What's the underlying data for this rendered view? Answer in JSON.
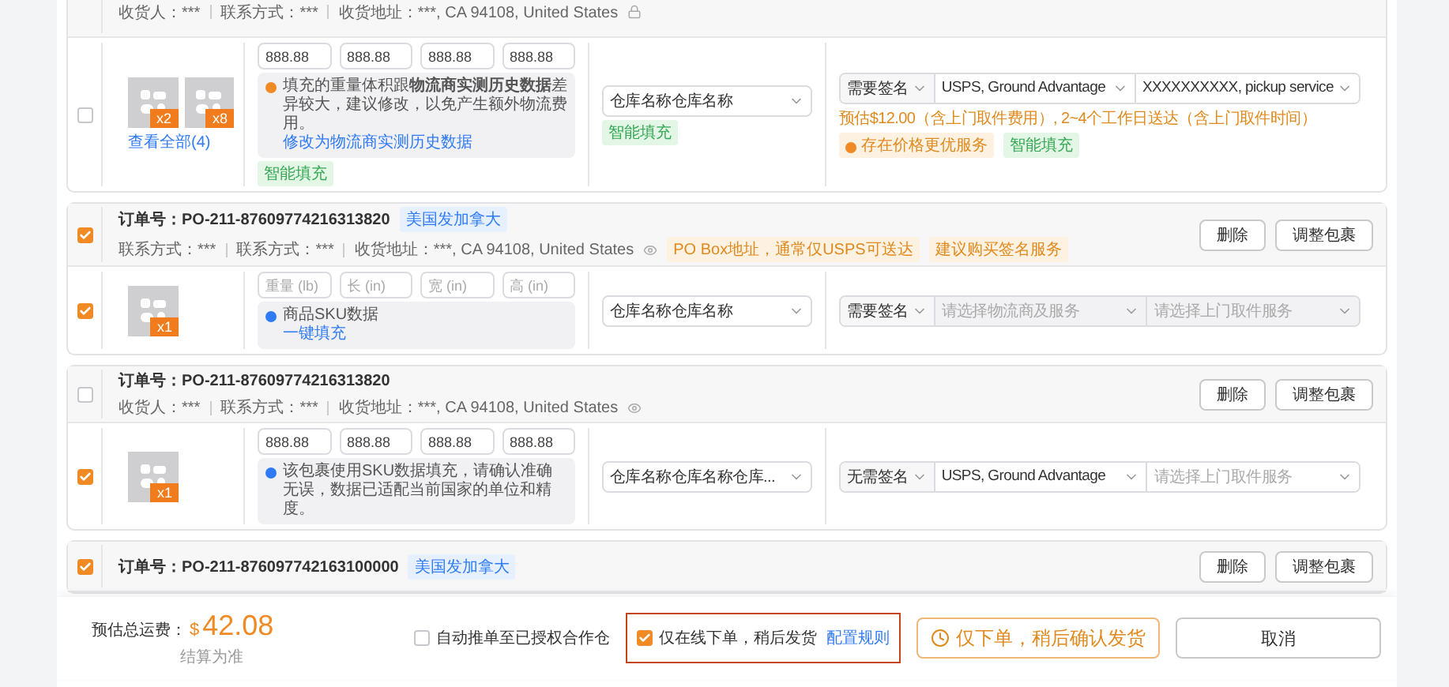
{
  "orders": [
    {
      "meta": [
        "收货人：***",
        "联系方式：***",
        "收货地址：***, CA 94108, United States"
      ],
      "address_locked": true,
      "items": [
        {
          "selected": false,
          "thumbs": [
            {
              "qty": "x2"
            },
            {
              "qty": "x8"
            }
          ],
          "view_all": "查看全部(4)",
          "dims": [
            {
              "value": "888.88"
            },
            {
              "value": "888.88"
            },
            {
              "value": "888.88"
            },
            {
              "value": "888.88"
            }
          ],
          "notice": {
            "kind": "warning",
            "text": "填充的重量体积跟**物流商实测历史数据**差异较大，建议修改，以免产生额外物流费用。",
            "link": "修改为物流商实测历史数据"
          },
          "dims_tag": "智能填充",
          "warehouse": "仓库名称仓库名称",
          "warehouse_tag": "智能填充",
          "signature": "需要签名",
          "carrier": {
            "value": "USPS, Ground Advantage",
            "disabled": false
          },
          "pickup": {
            "value": "XXXXXXXXXX, pickup service",
            "disabled": false
          },
          "estimate": "预估$12.00（含上门取件费用）, 2~4个工作日送达（含上门取件时间）",
          "badges": [
            {
              "kind": "warning",
              "text": "存在价格更优服务"
            },
            {
              "kind": "smart",
              "text": "智能填充"
            }
          ]
        }
      ]
    },
    {
      "selected": true,
      "order_no": "订单号：PO-211-87609774216313820",
      "tag": "美国发加拿大",
      "meta": [
        "联系方式：***",
        "联系方式：***",
        "收货地址：***, CA 94108, United States"
      ],
      "address_locked": false,
      "warnings": [
        "PO Box地址，通常仅USPS可送达",
        "建议购买签名服务"
      ],
      "buttons": [
        "删除",
        "调整包裹"
      ],
      "items": [
        {
          "selected": true,
          "thumbs": [
            {
              "qty": "x1"
            }
          ],
          "dims": [
            {
              "placeholder": "重量 (lb)"
            },
            {
              "placeholder": "长 (in)"
            },
            {
              "placeholder": "宽 (in)"
            },
            {
              "placeholder": "高 (in)"
            }
          ],
          "notice": {
            "kind": "info",
            "text": "商品SKU数据",
            "link": "一键填充"
          },
          "warehouse": "仓库名称仓库名称",
          "signature": "需要签名",
          "carrier": {
            "placeholder": "请选择物流商及服务",
            "disabled": true
          },
          "pickup": {
            "placeholder": "请选择上门取件服务",
            "disabled": true
          }
        }
      ]
    },
    {
      "selected": false,
      "order_no": "订单号：PO-211-87609774216313820",
      "meta": [
        "收货人：***",
        "联系方式：***",
        "收货地址：***, CA 94108, United States"
      ],
      "address_locked": false,
      "buttons": [
        "删除",
        "调整包裹"
      ],
      "items": [
        {
          "selected": true,
          "thumbs": [
            {
              "qty": "x1"
            }
          ],
          "dims": [
            {
              "value": "888.88"
            },
            {
              "value": "888.88"
            },
            {
              "value": "888.88"
            },
            {
              "value": "888.88"
            }
          ],
          "notice": {
            "kind": "info",
            "text": "该包裹使用SKU数据填充，请确认准确无误，数据已适配当前国家的单位和精度。"
          },
          "warehouse": "仓库名称仓库名称仓库...",
          "signature": "无需签名",
          "carrier": {
            "value": "USPS, Ground Advantage",
            "disabled": false
          },
          "pickup": {
            "placeholder": "请选择上门取件服务",
            "disabled": false
          }
        }
      ]
    },
    {
      "selected": true,
      "order_no": "订单号：PO-211-876097742163100000",
      "tag": "美国发加拿大",
      "buttons": [
        "删除",
        "调整包裹"
      ]
    }
  ],
  "footer": {
    "total_label": "预估总运费：",
    "currency": "$",
    "total": "42.08",
    "note": "结算为准",
    "auto_push": {
      "label": "自动推单至已授权合作仓",
      "checked": false
    },
    "online_only": {
      "label": "仅在线下单，稍后发货",
      "checked": true,
      "link": "配置规则"
    },
    "primary_button": "仅下单，稍后确认发货",
    "cancel_button": "取消"
  }
}
